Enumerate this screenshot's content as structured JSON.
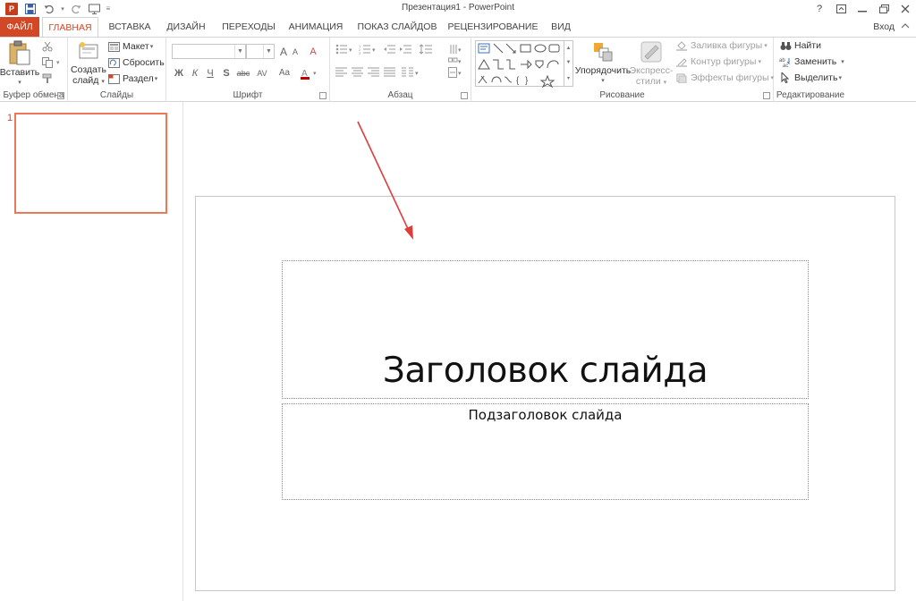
{
  "window": {
    "title": "Презентация1 - PowerPoint",
    "help": "?",
    "app_badge": "P"
  },
  "tabs": [
    {
      "label": "ФАЙЛ"
    },
    {
      "label": "ГЛАВНАЯ"
    },
    {
      "label": "ВСТАВКА"
    },
    {
      "label": "ДИЗАЙН"
    },
    {
      "label": "ПЕРЕХОДЫ"
    },
    {
      "label": "АНИМАЦИЯ"
    },
    {
      "label": "ПОКАЗ СЛАЙДОВ"
    },
    {
      "label": "РЕЦЕНЗИРОВАНИЕ"
    },
    {
      "label": "ВИД"
    }
  ],
  "signin": "Вход",
  "ribbon": {
    "clipboard": {
      "paste": "Вставить",
      "label": "Буфер обмена"
    },
    "slides": {
      "new_slide_1": "Создать",
      "new_slide_2": "слайд",
      "layout": "Макет",
      "reset": "Сбросить",
      "section": "Раздел",
      "label": "Слайды"
    },
    "font": {
      "bold": "Ж",
      "italic": "К",
      "underline": "Ч",
      "shadow": "S",
      "strike": "abc",
      "spacing": "AV",
      "case": "Aa",
      "grow": "A",
      "shrink": "A",
      "clear": "A",
      "label": "Шрифт"
    },
    "paragraph": {
      "label": "Абзац"
    },
    "drawing": {
      "arrange": "Упорядочить",
      "quick_styles_1": "Экспресс-",
      "quick_styles_2": "стили",
      "fill": "Заливка фигуры",
      "outline": "Контур фигуры",
      "effects": "Эффекты фигуры",
      "label": "Рисование"
    },
    "editing": {
      "find": "Найти",
      "replace": "Заменить",
      "select": "Выделить",
      "label": "Редактирование"
    }
  },
  "thumbnails": [
    {
      "number": "1"
    }
  ],
  "slide": {
    "title_placeholder": "Заголовок слайда",
    "subtitle_placeholder": "Подзаголовок слайда"
  },
  "colors": {
    "accent": "#d24726",
    "thumb_border": "#ec7857",
    "arrow": "#e03c3c"
  }
}
